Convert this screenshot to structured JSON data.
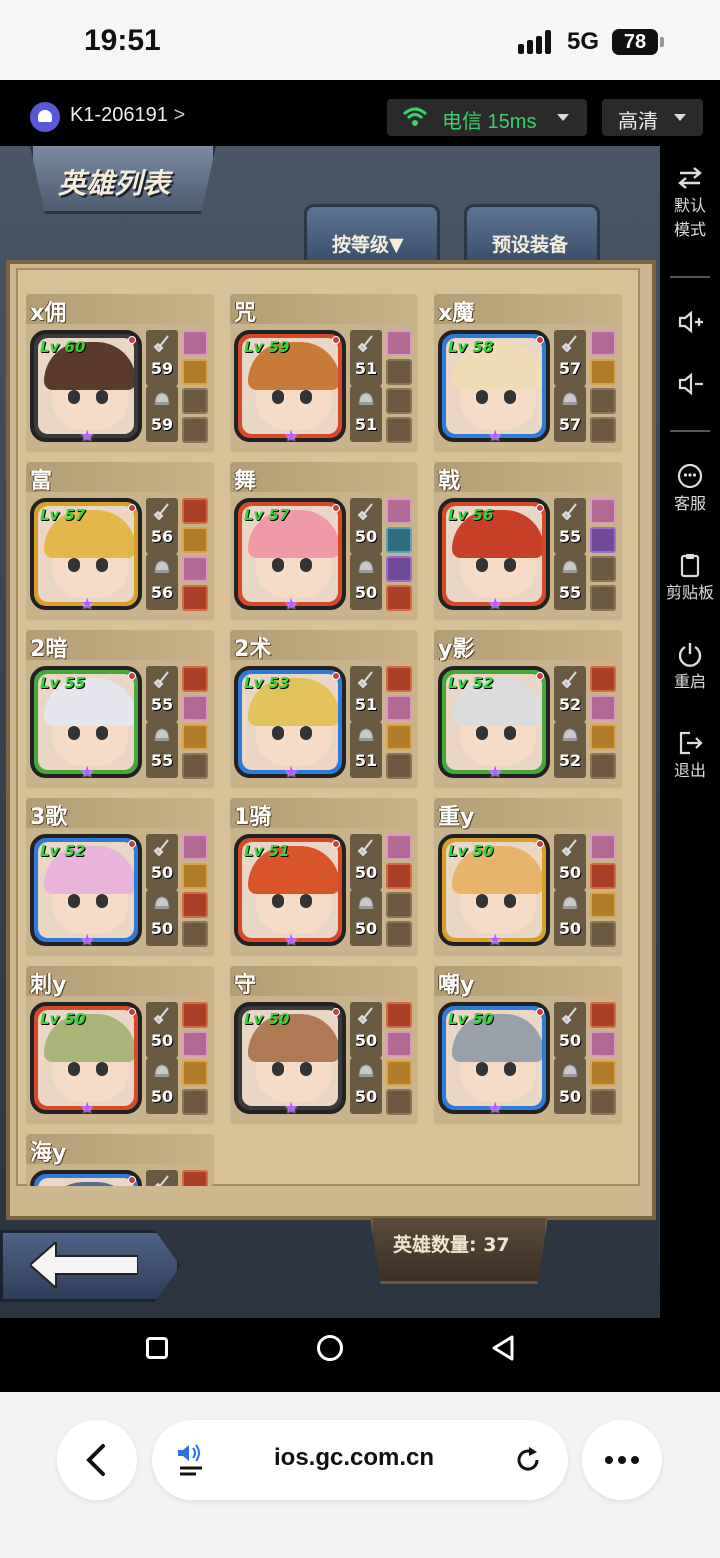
{
  "status_bar": {
    "time": "19:51",
    "network": "5G",
    "battery": "78"
  },
  "cloud_bar": {
    "device_id": "K1-206191",
    "network_label": "电信 15ms",
    "quality_label": "高清",
    "accent": "#3fcf6a"
  },
  "side_panel": {
    "items": [
      {
        "icon": "swap-icon",
        "label": "默认\n模式"
      },
      {
        "icon": "volume-up-icon",
        "label": ""
      },
      {
        "icon": "volume-down-icon",
        "label": ""
      },
      {
        "icon": "customer-service-icon",
        "label": "客服"
      },
      {
        "icon": "clipboard-icon",
        "label": "剪贴板"
      },
      {
        "icon": "power-icon",
        "label": "重启"
      },
      {
        "icon": "exit-icon",
        "label": "退出"
      }
    ]
  },
  "game": {
    "title": "英雄列表",
    "tabs": [
      "按等级▼",
      "预设装备"
    ],
    "hero_count_label": "英雄数量: 37",
    "heroes": [
      {
        "name": "x佣",
        "level": "Lv 60",
        "attack": "59",
        "defense": "59",
        "frame": "#3a3a3a",
        "hair": "#5a3a2a",
        "slots": [
          "pink",
          "gold",
          "",
          ""
        ]
      },
      {
        "name": "咒",
        "level": "Lv 59",
        "attack": "51",
        "defense": "51",
        "frame": "#d24a2a",
        "hair": "#c87a3a",
        "slots": [
          "pink",
          "",
          "",
          ""
        ]
      },
      {
        "name": "x魔",
        "level": "Lv 58",
        "attack": "57",
        "defense": "57",
        "frame": "#2f7ad8",
        "hair": "#f0dcb4",
        "slots": [
          "pink",
          "gold",
          "",
          ""
        ]
      },
      {
        "name": "富",
        "level": "Lv 57",
        "attack": "56",
        "defense": "56",
        "frame": "#d8a02a",
        "hair": "#e2b84a",
        "slots": [
          "red",
          "gold",
          "pink",
          "red"
        ]
      },
      {
        "name": "舞",
        "level": "Lv 57",
        "attack": "50",
        "defense": "50",
        "frame": "#d24a2a",
        "hair": "#ef9aa6",
        "slots": [
          "pink",
          "teal",
          "purple",
          "red"
        ]
      },
      {
        "name": "戟",
        "level": "Lv 56",
        "attack": "55",
        "defense": "55",
        "frame": "#d24a2a",
        "hair": "#c8402a",
        "slots": [
          "pink",
          "purple",
          "",
          ""
        ]
      },
      {
        "name": "2暗",
        "level": "Lv 55",
        "attack": "55",
        "defense": "55",
        "frame": "#46a83a",
        "hair": "#e6e6ee",
        "slots": [
          "red",
          "pink",
          "gold",
          ""
        ]
      },
      {
        "name": "2术",
        "level": "Lv 53",
        "attack": "51",
        "defense": "51",
        "frame": "#2f7ad8",
        "hair": "#e2c25a",
        "slots": [
          "red",
          "pink",
          "gold",
          ""
        ]
      },
      {
        "name": "y影",
        "level": "Lv 52",
        "attack": "52",
        "defense": "52",
        "frame": "#46a83a",
        "hair": "#dcdcdc",
        "slots": [
          "red",
          "pink",
          "gold",
          ""
        ]
      },
      {
        "name": "3歌",
        "level": "Lv 52",
        "attack": "50",
        "defense": "50",
        "frame": "#2f7ad8",
        "hair": "#e8b4dc",
        "slots": [
          "pink",
          "gold",
          "red",
          ""
        ]
      },
      {
        "name": "1骑",
        "level": "Lv 51",
        "attack": "50",
        "defense": "50",
        "frame": "#d24a2a",
        "hair": "#d8542a",
        "slots": [
          "pink",
          "red",
          "",
          ""
        ]
      },
      {
        "name": "重y",
        "level": "Lv 50",
        "attack": "50",
        "defense": "50",
        "frame": "#d8a02a",
        "hair": "#e6b46a",
        "slots": [
          "pink",
          "red",
          "gold",
          ""
        ]
      },
      {
        "name": "刺y",
        "level": "Lv 50",
        "attack": "50",
        "defense": "50",
        "frame": "#d24a2a",
        "hair": "#a8b478",
        "slots": [
          "red",
          "pink",
          "gold",
          ""
        ]
      },
      {
        "name": "守",
        "level": "Lv 50",
        "attack": "50",
        "defense": "50",
        "frame": "#3a3a3a",
        "hair": "#b07a54",
        "slots": [
          "red",
          "pink",
          "gold",
          ""
        ]
      },
      {
        "name": "嘲y",
        "level": "Lv 50",
        "attack": "50",
        "defense": "50",
        "frame": "#2f7ad8",
        "hair": "#9aa0aa",
        "slots": [
          "red",
          "pink",
          "gold",
          ""
        ]
      },
      {
        "name": "海y",
        "level": "",
        "attack": "",
        "defense": "",
        "frame": "#2f7ad8",
        "hair": "#5a6a8a",
        "slots": [
          "red",
          "",
          "",
          ""
        ]
      }
    ]
  },
  "browser": {
    "url": "ios.gc.com.cn"
  }
}
